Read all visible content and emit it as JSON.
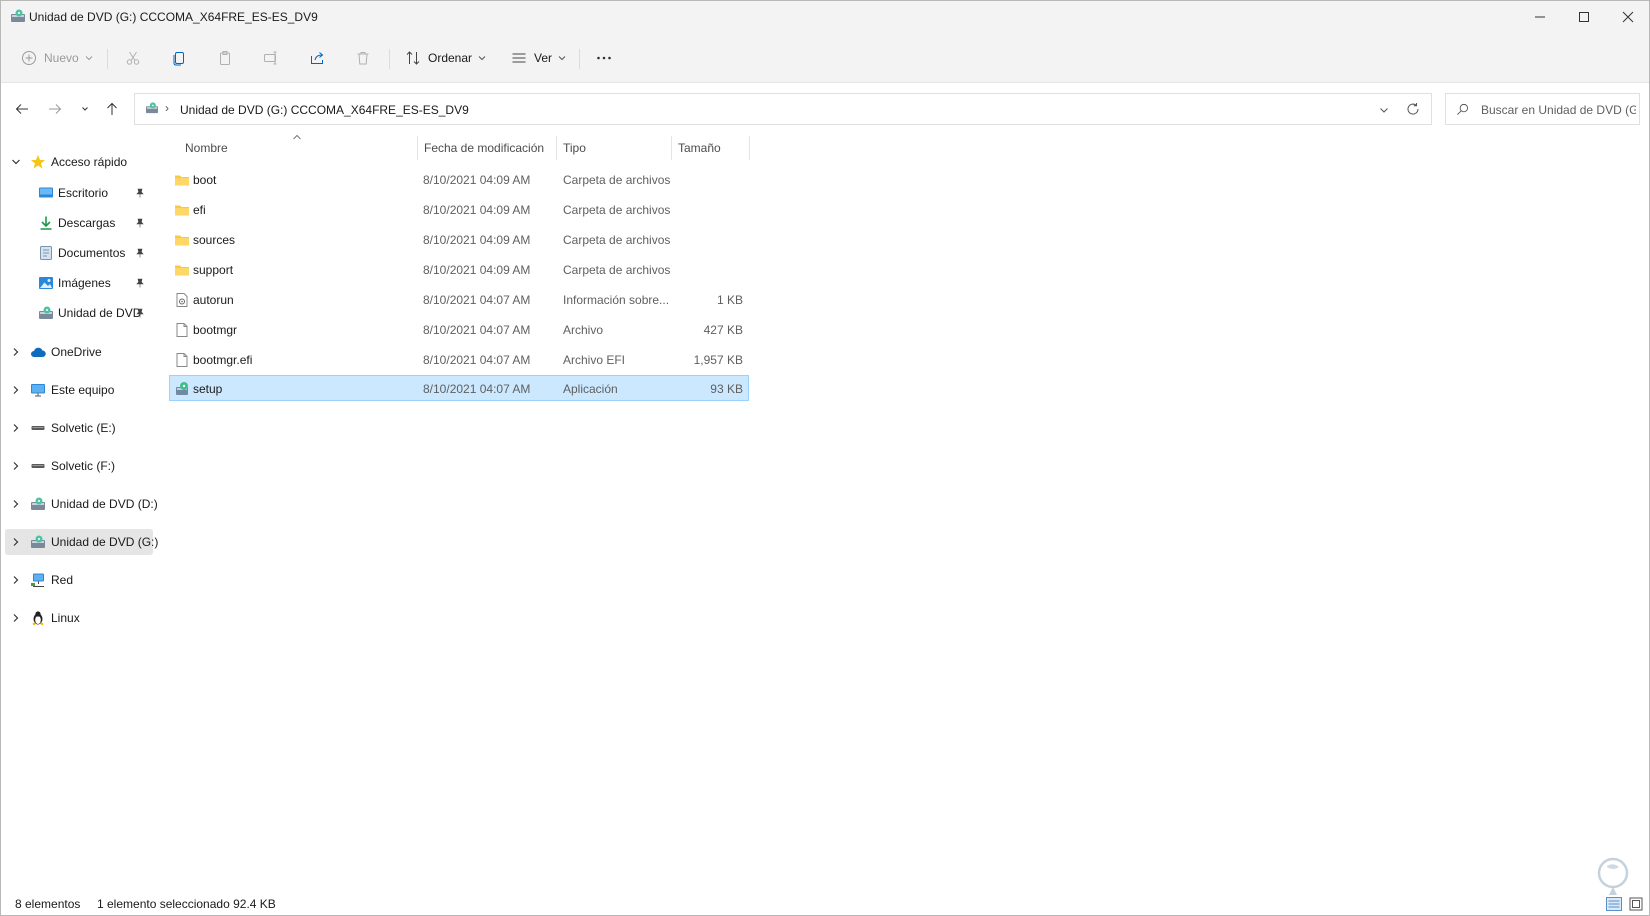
{
  "window": {
    "title": "Unidad de DVD (G:) CCCOMA_X64FRE_ES-ES_DV9"
  },
  "toolbar": {
    "new_label": "Nuevo",
    "sort_label": "Ordenar",
    "view_label": "Ver"
  },
  "address": {
    "path": "Unidad de DVD (G:) CCCOMA_X64FRE_ES-ES_DV9",
    "separator": "›"
  },
  "search": {
    "placeholder": "Buscar en Unidad de DVD (G:)"
  },
  "sidebar": {
    "quick_access": "Acceso rápido",
    "pinned": [
      {
        "label": "Escritorio",
        "icon": "desktop-icon"
      },
      {
        "label": "Descargas",
        "icon": "download-icon"
      },
      {
        "label": "Documentos",
        "icon": "documents-icon"
      },
      {
        "label": "Imágenes",
        "icon": "pictures-icon"
      },
      {
        "label": "Unidad de DVD",
        "icon": "dvd-drive-icon"
      }
    ],
    "roots": [
      {
        "label": "OneDrive",
        "icon": "cloud-icon"
      },
      {
        "label": "Este equipo",
        "icon": "computer-icon"
      },
      {
        "label": "Solvetic (E:)",
        "icon": "drive-icon"
      },
      {
        "label": "Solvetic (F:)",
        "icon": "drive-icon"
      },
      {
        "label": "Unidad de DVD (D:)",
        "icon": "dvd-drive-icon"
      },
      {
        "label": "Unidad de DVD (G:)",
        "icon": "dvd-drive-icon"
      },
      {
        "label": "Red",
        "icon": "network-icon"
      },
      {
        "label": "Linux",
        "icon": "linux-icon"
      }
    ]
  },
  "columns": {
    "name": "Nombre",
    "date": "Fecha de modificación",
    "type": "Tipo",
    "size": "Tamaño"
  },
  "files": [
    {
      "name": "boot",
      "date": "8/10/2021 04:09 AM",
      "type": "Carpeta de archivos",
      "size": "",
      "icon": "folder-icon"
    },
    {
      "name": "efi",
      "date": "8/10/2021 04:09 AM",
      "type": "Carpeta de archivos",
      "size": "",
      "icon": "folder-icon"
    },
    {
      "name": "sources",
      "date": "8/10/2021 04:09 AM",
      "type": "Carpeta de archivos",
      "size": "",
      "icon": "folder-icon"
    },
    {
      "name": "support",
      "date": "8/10/2021 04:09 AM",
      "type": "Carpeta de archivos",
      "size": "",
      "icon": "folder-icon"
    },
    {
      "name": "autorun",
      "date": "8/10/2021 04:07 AM",
      "type": "Información sobre...",
      "size": "1 KB",
      "icon": "settings-file-icon"
    },
    {
      "name": "bootmgr",
      "date": "8/10/2021 04:07 AM",
      "type": "Archivo",
      "size": "427 KB",
      "icon": "file-icon"
    },
    {
      "name": "bootmgr.efi",
      "date": "8/10/2021 04:07 AM",
      "type": "Archivo EFI",
      "size": "1,957 KB",
      "icon": "file-icon"
    },
    {
      "name": "setup",
      "date": "8/10/2021 04:07 AM",
      "type": "Aplicación",
      "size": "93 KB",
      "icon": "setup-app-icon"
    }
  ],
  "status": {
    "count": "8 elementos",
    "selection": "1 elemento seleccionado  92.4 KB"
  },
  "colors": {
    "selection_bg": "#cce8ff",
    "selection_border": "#99d1ff",
    "folder": "#f8c84a",
    "accent": "#0067c0"
  }
}
